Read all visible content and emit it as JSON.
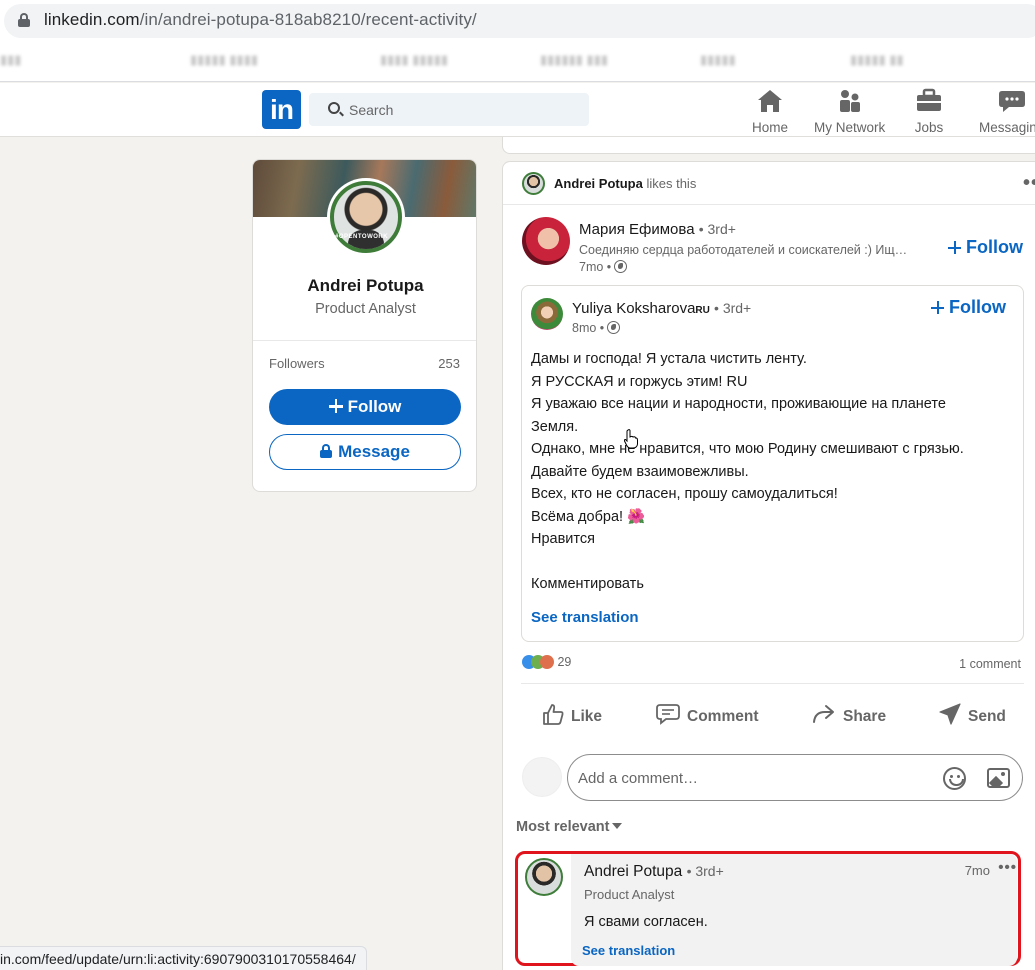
{
  "browser": {
    "url_host": "linkedin.com",
    "url_path": "/in/andrei-potupa-818ab8210/recent-activity/",
    "status_url": "in.com/feed/update/urn:li:activity:6907900310170558464/"
  },
  "navbar": {
    "logo": "in",
    "search_placeholder": "Search",
    "items": [
      {
        "label": "Home",
        "icon": "home-icon"
      },
      {
        "label": "My Network",
        "icon": "network-icon"
      },
      {
        "label": "Jobs",
        "icon": "briefcase-icon"
      },
      {
        "label": "Messaging",
        "icon": "messaging-icon"
      }
    ]
  },
  "profile": {
    "name": "Andrei Potupa",
    "headline": "Product Analyst",
    "avatar_badge": "#OPENTOWORK",
    "followers_label": "Followers",
    "followers_count": "253",
    "follow_label": "Follow",
    "message_label": "Message"
  },
  "activity": {
    "actor": "Andrei Potupa",
    "action": "likes this"
  },
  "post": {
    "author_name": "Мария Ефимова",
    "author_degree": "• 3rd+",
    "author_headline": "Соединяю сердца работодателей и соискателей :) Ищ…",
    "author_time": "7mo •",
    "follow_label": "Follow",
    "reshare": {
      "author_name": "Yuliya Koksharova",
      "author_flag": "RU",
      "author_degree": "• 3rd+",
      "time": "8mo •",
      "follow_label": "Follow",
      "text_lines": [
        "Дамы и господа! Я устала чистить ленту.",
        "Я РУССКАЯ и горжусь этим! RU",
        "Я уважаю все нации и народности, проживающие на планете",
        "Земля.",
        "Однако, мне не нравится, что мою Родину смешивают с грязью.",
        "Давайте будем взаимовежливы.",
        "Всех, кто не согласен, прошу самоудалиться!",
        "Всёма добра! 🌺",
        "Нравится",
        "",
        "Комментировать"
      ],
      "see_translation": "See translation"
    },
    "reactions_count": "29",
    "comments_count": "1 comment",
    "actions": {
      "like": "Like",
      "comment": "Comment",
      "share": "Share",
      "send": "Send"
    },
    "comment_placeholder": "Add a comment…",
    "sort_label": "Most relevant",
    "comment": {
      "author_name": "Andrei Potupa",
      "author_degree": "• 3rd+",
      "author_headline": "Product Analyst",
      "time": "7mo",
      "text": "Я свами согласен.",
      "see_translation": "See translation"
    }
  },
  "colors": {
    "linkedin_blue": "#0a66c2",
    "highlight_red": "#e0141c",
    "page_bg": "#f3f2ef"
  }
}
